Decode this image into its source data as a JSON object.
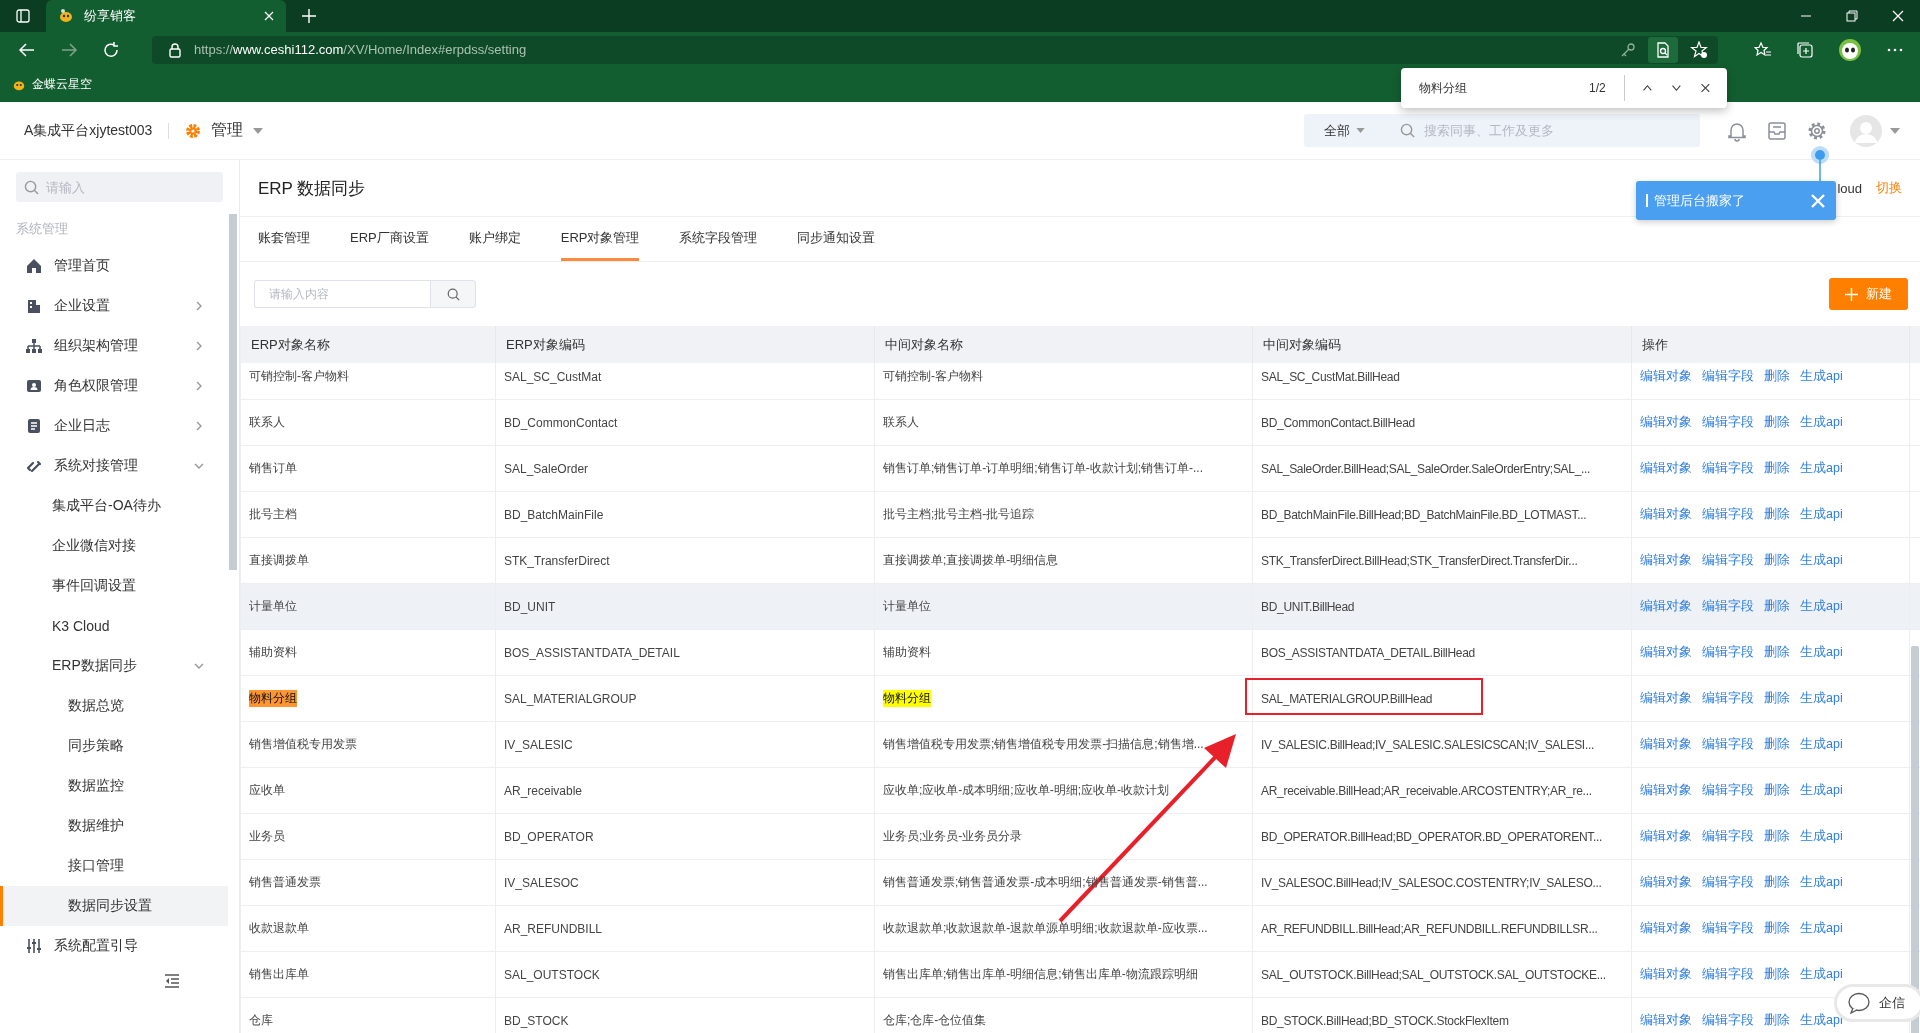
{
  "browser": {
    "tab_title": "纷享销客",
    "url_prefix": "https://",
    "url_host": "www.ceshi112.com",
    "url_path": "/XV/Home/Index#erpdss/setting",
    "bookmark": "金蝶云星空"
  },
  "find_bar": {
    "query": "物料分组",
    "count": "1/2"
  },
  "header": {
    "org": "A集成平台xjytest003",
    "app": "管理",
    "scope": "全部",
    "search_placeholder": "搜索同事、工作及更多"
  },
  "sidebar": {
    "search_placeholder": "请输入",
    "section": "系统管理",
    "items": [
      {
        "label": "管理首页",
        "kind": "link",
        "selected": false
      },
      {
        "label": "企业设置",
        "kind": "group",
        "expanded": false,
        "selected": false
      },
      {
        "label": "组织架构管理",
        "kind": "group",
        "expanded": false,
        "selected": false
      },
      {
        "label": "角色权限管理",
        "kind": "group",
        "expanded": false,
        "selected": false
      },
      {
        "label": "企业日志",
        "kind": "group",
        "expanded": false,
        "selected": false
      },
      {
        "label": "系统对接管理",
        "kind": "group",
        "expanded": true,
        "selected": false,
        "children": [
          {
            "label": "集成平台-OA待办",
            "kind": "link",
            "selected": false
          },
          {
            "label": "企业微信对接",
            "kind": "link",
            "selected": false
          },
          {
            "label": "事件回调设置",
            "kind": "link",
            "selected": false
          },
          {
            "label": "K3 Cloud",
            "kind": "link",
            "selected": false
          },
          {
            "label": "ERP数据同步",
            "kind": "group",
            "expanded": true,
            "selected": false,
            "children": [
              {
                "label": "数据总览",
                "selected": false
              },
              {
                "label": "同步策略",
                "selected": false
              },
              {
                "label": "数据监控",
                "selected": false
              },
              {
                "label": "数据维护",
                "selected": false
              },
              {
                "label": "接口管理",
                "selected": false
              },
              {
                "label": "数据同步设置",
                "selected": true
              }
            ]
          }
        ]
      },
      {
        "label": "系统配置引导",
        "kind": "link",
        "selected": false
      }
    ]
  },
  "page": {
    "title": "ERP 数据同步",
    "account_visible": "loud",
    "switch_link": "切换",
    "notice": "管理后台搬家了",
    "tabs": [
      {
        "label": "账套管理",
        "selected": false
      },
      {
        "label": "ERP厂商设置",
        "selected": false
      },
      {
        "label": "账户绑定",
        "selected": false
      },
      {
        "label": "ERP对象管理",
        "selected": true
      },
      {
        "label": "系统字段管理",
        "selected": false
      },
      {
        "label": "同步通知设置",
        "selected": false
      }
    ],
    "filter_placeholder": "请输入内容",
    "new_button": "新建"
  },
  "table": {
    "columns": [
      "ERP对象名称",
      "ERP对象编码",
      "中间对象名称",
      "中间对象编码",
      "操作"
    ],
    "rows": [
      {
        "name": "可销控制-客户物料",
        "code": "SAL_SC_CustMat",
        "mid_name": "可销控制-客户物料",
        "mid_code": "SAL_SC_CustMat.BillHead",
        "hovered": false,
        "find_match": false,
        "actions": [
          "编辑对象",
          "编辑字段",
          "删除",
          "生成api"
        ]
      },
      {
        "name": "联系人",
        "code": "BD_CommonContact",
        "mid_name": "联系人",
        "mid_code": "BD_CommonContact.BillHead",
        "hovered": false,
        "find_match": false,
        "actions": [
          "编辑对象",
          "编辑字段",
          "删除",
          "生成api"
        ]
      },
      {
        "name": "销售订单",
        "code": "SAL_SaleOrder",
        "mid_name": "销售订单;销售订单-订单明细;销售订单-收款计划;销售订单-...",
        "mid_code": "SAL_SaleOrder.BillHead;SAL_SaleOrder.SaleOrderEntry;SAL_...",
        "hovered": false,
        "find_match": false,
        "actions": [
          "编辑对象",
          "编辑字段",
          "删除",
          "生成api"
        ]
      },
      {
        "name": "批号主档",
        "code": "BD_BatchMainFile",
        "mid_name": "批号主档;批号主档-批号追踪",
        "mid_code": "BD_BatchMainFile.BillHead;BD_BatchMainFile.BD_LOTMAST...",
        "hovered": false,
        "find_match": false,
        "actions": [
          "编辑对象",
          "编辑字段",
          "删除",
          "生成api"
        ]
      },
      {
        "name": "直接调拨单",
        "code": "STK_TransferDirect",
        "mid_name": "直接调拨单;直接调拨单-明细信息",
        "mid_code": "STK_TransferDirect.BillHead;STK_TransferDirect.TransferDir...",
        "hovered": false,
        "find_match": false,
        "actions": [
          "编辑对象",
          "编辑字段",
          "删除",
          "生成api"
        ]
      },
      {
        "name": "计量单位",
        "code": "BD_UNIT",
        "mid_name": "计量单位",
        "mid_code": "BD_UNIT.BillHead",
        "hovered": true,
        "find_match": false,
        "actions": [
          "编辑对象",
          "编辑字段",
          "删除",
          "生成api"
        ]
      },
      {
        "name": "辅助资料",
        "code": "BOS_ASSISTANTDATA_DETAIL",
        "mid_name": "辅助资料",
        "mid_code": "BOS_ASSISTANTDATA_DETAIL.BillHead",
        "hovered": false,
        "find_match": false,
        "actions": [
          "编辑对象",
          "编辑字段",
          "删除",
          "生成api"
        ]
      },
      {
        "name": "物料分组",
        "code": "SAL_MATERIALGROUP",
        "mid_name": "物料分组",
        "mid_code": "SAL_MATERIALGROUP.BillHead",
        "hovered": false,
        "find_match": true,
        "actions": [
          "编辑对象",
          "编辑字段",
          "删除",
          "生成api"
        ]
      },
      {
        "name": "销售增值税专用发票",
        "code": "IV_SALESIC",
        "mid_name": "销售增值税专用发票;销售增值税专用发票-扫描信息;销售增...",
        "mid_code": "IV_SALESIC.BillHead;IV_SALESIC.SALESICSCAN;IV_SALESI...",
        "hovered": false,
        "find_match": false,
        "actions": [
          "编辑对象",
          "编辑字段",
          "删除",
          "生成api"
        ]
      },
      {
        "name": "应收单",
        "code": "AR_receivable",
        "mid_name": "应收单;应收单-成本明细;应收单-明细;应收单-收款计划",
        "mid_code": "AR_receivable.BillHead;AR_receivable.ARCOSTENTRY;AR_re...",
        "hovered": false,
        "find_match": false,
        "actions": [
          "编辑对象",
          "编辑字段",
          "删除",
          "生成api"
        ]
      },
      {
        "name": "业务员",
        "code": "BD_OPERATOR",
        "mid_name": "业务员;业务员-业务员分录",
        "mid_code": "BD_OPERATOR.BillHead;BD_OPERATOR.BD_OPERATORENT...",
        "hovered": false,
        "find_match": false,
        "actions": [
          "编辑对象",
          "编辑字段",
          "删除",
          "生成api"
        ]
      },
      {
        "name": "销售普通发票",
        "code": "IV_SALESOC",
        "mid_name": "销售普通发票;销售普通发票-成本明细;销售普通发票-销售普...",
        "mid_code": "IV_SALESOC.BillHead;IV_SALESOC.COSTENTRY;IV_SALESO...",
        "hovered": false,
        "find_match": false,
        "actions": [
          "编辑对象",
          "编辑字段",
          "删除",
          "生成api"
        ]
      },
      {
        "name": "收款退款单",
        "code": "AR_REFUNDBILL",
        "mid_name": "收款退款单;收款退款单-退款单源单明细;收款退款单-应收票...",
        "mid_code": "AR_REFUNDBILL.BillHead;AR_REFUNDBILL.REFUNDBILLSR...",
        "hovered": false,
        "find_match": false,
        "actions": [
          "编辑对象",
          "编辑字段",
          "删除",
          "生成api"
        ]
      },
      {
        "name": "销售出库单",
        "code": "SAL_OUTSTOCK",
        "mid_name": "销售出库单;销售出库单-明细信息;销售出库单-物流跟踪明细",
        "mid_code": "SAL_OUTSTOCK.BillHead;SAL_OUTSTOCK.SAL_OUTSTOCKE...",
        "hovered": false,
        "find_match": false,
        "actions": [
          "编辑对象",
          "编辑字段",
          "删除",
          "生成api"
        ]
      },
      {
        "name": "仓库",
        "code": "BD_STOCK",
        "mid_name": "仓库;仓库-仓位值集",
        "mid_code": "BD_STOCK.BillHead;BD_STOCK.StockFlexItem",
        "hovered": false,
        "find_match": false,
        "actions": [
          "编辑对象",
          "编辑字段",
          "删除",
          "生成api"
        ]
      }
    ]
  },
  "chat_widget": {
    "label": "企信"
  }
}
